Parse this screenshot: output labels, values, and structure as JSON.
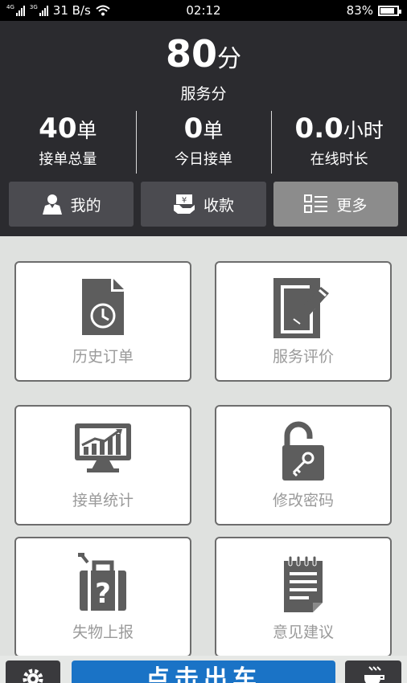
{
  "status_bar": {
    "net1": "4G",
    "net2": "3G",
    "speed": "31 B/s",
    "time": "02:12",
    "battery": "83%",
    "battery_level": 0.83,
    "icons": [
      "signal-icon",
      "wifi-icon",
      "battery-icon"
    ]
  },
  "header": {
    "score_value": "80",
    "score_unit": "分",
    "score_label": "服务分",
    "stats": [
      {
        "value": "40",
        "unit": "单",
        "label": "接单总量"
      },
      {
        "value": "0",
        "unit": "单",
        "label": "今日接单"
      },
      {
        "value": "0.0",
        "unit": "小时",
        "label": "在线时长"
      }
    ],
    "actions": [
      {
        "label": "我的",
        "icon": "user-icon"
      },
      {
        "label": "收款",
        "icon": "cash-icon"
      },
      {
        "label": "更多",
        "icon": "list-icon"
      }
    ]
  },
  "tiles": [
    {
      "label": "历史订单",
      "icon": "history-order-icon"
    },
    {
      "label": "服务评价",
      "icon": "edit-review-icon"
    },
    {
      "label": "接单统计",
      "icon": "statistics-chart-icon"
    },
    {
      "label": "修改密码",
      "icon": "unlock-key-icon"
    },
    {
      "label": "失物上报",
      "icon": "lost-luggage-icon"
    },
    {
      "label": "意见建议",
      "icon": "notepad-icon"
    }
  ],
  "bottom_bar": {
    "main_label": "点击出车",
    "icons": [
      "settings-icon",
      "coffee-icon"
    ]
  },
  "colors": {
    "header_bg": "#2b2b2f",
    "action_bg": "#4b4b50",
    "action_active_bg": "#8c8c8c",
    "grid_bg": "#dfe1df",
    "tile_icon": "#5d5d5d",
    "tile_label": "#9a9a9a",
    "primary_button": "#1a73c6"
  }
}
